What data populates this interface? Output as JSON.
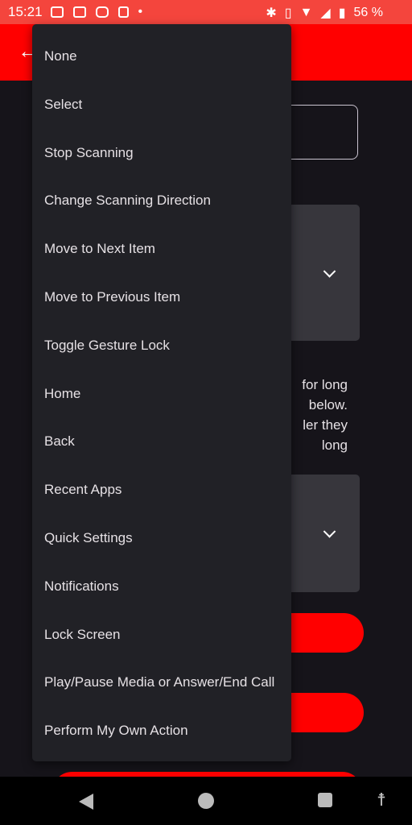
{
  "status_bar": {
    "time": "15:21",
    "battery": "56 %"
  },
  "background": {
    "paragraph_fragments": [
      "for long",
      "below.",
      "ler they",
      "long"
    ]
  },
  "menu": {
    "items": [
      "None",
      "Select",
      "Stop Scanning",
      "Change Scanning Direction",
      "Move to Next Item",
      "Move to Previous Item",
      "Toggle Gesture Lock",
      "Home",
      "Back",
      "Recent Apps",
      "Quick Settings",
      "Notifications",
      "Lock Screen",
      "Play/Pause Media or Answer/End Call",
      "Perform My Own Action"
    ]
  },
  "colors": {
    "accent": "#ff0000",
    "status_bar": "#f4453d",
    "menu_bg": "#212126",
    "page_bg": "#16141a"
  }
}
